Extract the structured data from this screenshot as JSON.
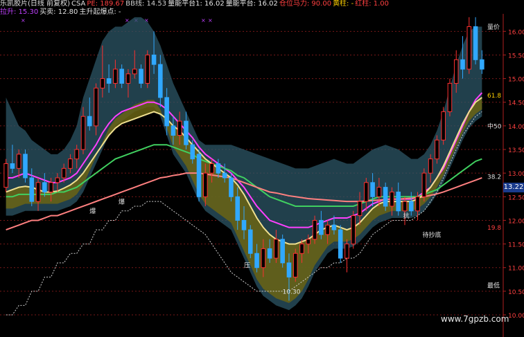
{
  "header": {
    "line1": [
      {
        "text": "乐凯胶片(日线 前复权)",
        "color": "#e0e0e0"
      },
      {
        "text": "CSA",
        "color": "#e0e0e0"
      },
      {
        "text": "PE: 189.67",
        "color": "#ff4040"
      },
      {
        "text": "BB线: 14.53",
        "color": "#d0d0d0"
      },
      {
        "text": "量能平台1: 16.02",
        "color": "#e8e8e8"
      },
      {
        "text": "量能平台: 16.02",
        "color": "#e8e8e8"
      },
      {
        "text": "仓位马力: 90.00",
        "color": "#ff4040"
      },
      {
        "text": "黄柱: -",
        "color": "#ffd000"
      },
      {
        "text": "红柱: 1.00",
        "color": "#ff4040"
      }
    ],
    "line2": [
      {
        "text": "拉升: 15.30",
        "color": "#c040ff"
      },
      {
        "text": "买卖: 12.80",
        "color": "#e0e0e0"
      },
      {
        "text": "主升起爆点: -",
        "color": "#e0e0e0"
      }
    ]
  },
  "watermark": "www.7gpzb.com",
  "current_price": "13.22",
  "chart_data": {
    "type": "candlestick",
    "ylim": [
      10.0,
      16.4
    ],
    "y_ticks": [
      "16.00",
      "15.50",
      "15.00",
      "14.50",
      "14.00",
      "13.50",
      "13.00",
      "12.50",
      "12.00",
      "11.50",
      "11.00",
      "10.50",
      "10.00"
    ],
    "annotations": [
      {
        "label": "量价",
        "x": 111,
        "y": 16.05,
        "color": "#e0e0e0"
      },
      {
        "label": "61.8",
        "x": 109,
        "y": 14.6,
        "color": "#ffd000"
      },
      {
        "label": "中50",
        "x": 109,
        "y": 13.95,
        "color": "#e0e0e0"
      },
      {
        "label": "38.2",
        "x": 109,
        "y": 12.88,
        "color": "#e0e0e0"
      },
      {
        "label": "19.8",
        "x": 109,
        "y": 11.8,
        "color": "#ff4040"
      },
      {
        "label": "最低",
        "x": 109,
        "y": 10.58,
        "color": "#e0e0e0"
      },
      {
        "label": "10.30",
        "x": 58,
        "y": 10.45,
        "color": "#e0e0e0"
      },
      {
        "label": "压",
        "x": 50,
        "y": 11.0,
        "color": "#e0e0e0"
      },
      {
        "label": "抗",
        "x": 83,
        "y": 12.05,
        "color": "#e0e0e0"
      },
      {
        "label": "待抄底",
        "x": 87,
        "y": 11.65,
        "color": "#e0e0e0"
      },
      {
        "label": "爆",
        "x": 18,
        "y": 12.15,
        "color": "#e0e0e0"
      },
      {
        "label": "爆",
        "x": 24,
        "y": 12.35,
        "color": "#e0e0e0"
      }
    ],
    "candles": [
      [
        12.7,
        13.3,
        12.6,
        13.2
      ],
      [
        13.2,
        13.6,
        13.0,
        13.1
      ],
      [
        13.1,
        13.5,
        12.9,
        13.4
      ],
      [
        13.4,
        13.5,
        12.8,
        12.9
      ],
      [
        12.9,
        13.1,
        12.3,
        12.4
      ],
      [
        12.4,
        12.9,
        12.2,
        12.8
      ],
      [
        12.8,
        13.0,
        12.5,
        12.6
      ],
      [
        12.6,
        12.9,
        12.4,
        12.8
      ],
      [
        12.8,
        13.0,
        12.6,
        12.9
      ],
      [
        12.9,
        13.2,
        12.8,
        13.1
      ],
      [
        13.1,
        13.4,
        13.0,
        13.3
      ],
      [
        13.3,
        13.6,
        13.1,
        13.5
      ],
      [
        13.5,
        14.4,
        13.4,
        14.2
      ],
      [
        14.2,
        14.6,
        13.9,
        14.0
      ],
      [
        14.0,
        14.9,
        13.8,
        14.8
      ],
      [
        14.8,
        15.7,
        14.6,
        15.0
      ],
      [
        15.0,
        15.3,
        14.7,
        14.9
      ],
      [
        14.9,
        15.4,
        14.8,
        15.2
      ],
      [
        15.2,
        15.3,
        14.8,
        14.9
      ],
      [
        14.9,
        15.2,
        14.6,
        15.1
      ],
      [
        15.1,
        15.6,
        15.0,
        15.2
      ],
      [
        15.2,
        15.3,
        14.8,
        14.9
      ],
      [
        14.9,
        15.6,
        14.8,
        15.5
      ],
      [
        15.5,
        16.0,
        15.1,
        15.3
      ],
      [
        15.3,
        15.5,
        14.4,
        14.6
      ],
      [
        14.6,
        14.8,
        13.8,
        14.0
      ],
      [
        14.0,
        14.2,
        13.6,
        13.8
      ],
      [
        13.8,
        14.3,
        13.6,
        14.1
      ],
      [
        14.1,
        14.3,
        13.5,
        13.6
      ],
      [
        13.6,
        13.7,
        13.2,
        13.3
      ],
      [
        13.4,
        13.5,
        12.4,
        12.5
      ],
      [
        12.5,
        13.2,
        12.3,
        13.0
      ],
      [
        13.0,
        13.3,
        12.8,
        13.2
      ],
      [
        13.2,
        13.3,
        12.9,
        13.0
      ],
      [
        13.0,
        13.2,
        12.8,
        12.9
      ],
      [
        12.9,
        13.0,
        12.4,
        12.5
      ],
      [
        12.5,
        12.7,
        11.8,
        12.0
      ],
      [
        12.0,
        12.3,
        11.6,
        11.8
      ],
      [
        11.8,
        11.9,
        11.2,
        11.3
      ],
      [
        11.3,
        11.5,
        10.9,
        11.0
      ],
      [
        11.0,
        11.6,
        10.8,
        11.4
      ],
      [
        11.4,
        11.6,
        11.1,
        11.2
      ],
      [
        11.2,
        11.8,
        11.1,
        11.6
      ],
      [
        11.6,
        11.7,
        11.0,
        11.1
      ],
      [
        11.1,
        11.3,
        10.3,
        10.8
      ],
      [
        10.8,
        11.4,
        10.7,
        11.3
      ],
      [
        11.3,
        11.6,
        11.1,
        11.5
      ],
      [
        11.5,
        11.7,
        11.3,
        11.6
      ],
      [
        11.6,
        12.1,
        11.5,
        12.0
      ],
      [
        12.0,
        12.2,
        11.6,
        11.7
      ],
      [
        11.7,
        12.0,
        11.5,
        11.9
      ],
      [
        11.9,
        12.1,
        11.7,
        11.8
      ],
      [
        11.8,
        11.9,
        11.1,
        11.2
      ],
      [
        11.2,
        11.6,
        10.9,
        11.5
      ],
      [
        11.5,
        12.2,
        11.4,
        12.1
      ],
      [
        12.1,
        12.6,
        11.9,
        12.4
      ],
      [
        12.4,
        12.9,
        12.2,
        12.8
      ],
      [
        12.8,
        13.0,
        12.3,
        12.5
      ],
      [
        12.5,
        12.9,
        12.3,
        12.7
      ],
      [
        12.7,
        12.8,
        12.2,
        12.3
      ],
      [
        12.3,
        12.7,
        12.1,
        12.6
      ],
      [
        12.6,
        12.8,
        12.1,
        12.2
      ],
      [
        12.2,
        12.5,
        11.9,
        12.4
      ],
      [
        12.4,
        12.6,
        12.1,
        12.2
      ],
      [
        12.2,
        12.6,
        12.0,
        12.5
      ],
      [
        12.5,
        13.1,
        12.4,
        13.0
      ],
      [
        13.0,
        13.4,
        12.8,
        13.3
      ],
      [
        13.3,
        13.8,
        13.2,
        13.7
      ],
      [
        13.7,
        14.4,
        13.6,
        14.3
      ],
      [
        14.3,
        15.0,
        14.2,
        14.9
      ],
      [
        14.9,
        15.6,
        14.7,
        15.4
      ],
      [
        15.4,
        15.9,
        15.0,
        15.2
      ],
      [
        15.2,
        16.3,
        15.1,
        16.1
      ],
      [
        16.1,
        16.3,
        15.3,
        15.4
      ],
      [
        15.4,
        15.6,
        15.1,
        15.2
      ]
    ],
    "ma_series": [
      {
        "color": "#ff40ff",
        "values": [
          12.9,
          12.9,
          12.95,
          13.0,
          12.95,
          12.9,
          12.85,
          12.8,
          12.8,
          12.85,
          12.9,
          13.0,
          13.2,
          13.4,
          13.6,
          13.85,
          14.05,
          14.2,
          14.3,
          14.35,
          14.4,
          14.45,
          14.5,
          14.5,
          14.45,
          14.35,
          14.2,
          14.05,
          13.9,
          13.75,
          13.55,
          13.4,
          13.3,
          13.2,
          13.1,
          13.0,
          12.85,
          12.7,
          12.5,
          12.3,
          12.15,
          12.0,
          11.95,
          11.9,
          11.85,
          11.85,
          11.85,
          11.85,
          11.9,
          11.95,
          12.0,
          12.05,
          12.05,
          12.05,
          12.1,
          12.15,
          12.25,
          12.35,
          12.4,
          12.45,
          12.45,
          12.45,
          12.45,
          12.45,
          12.5,
          12.6,
          12.7,
          12.9,
          13.1,
          13.4,
          13.7,
          14.0,
          14.3,
          14.55,
          14.7
        ]
      },
      {
        "color": "#40d060",
        "values": [
          12.5,
          12.5,
          12.55,
          12.55,
          12.55,
          12.55,
          12.55,
          12.55,
          12.6,
          12.6,
          12.65,
          12.7,
          12.8,
          12.9,
          13.0,
          13.1,
          13.2,
          13.3,
          13.35,
          13.4,
          13.45,
          13.5,
          13.55,
          13.6,
          13.6,
          13.6,
          13.55,
          13.5,
          13.45,
          13.4,
          13.3,
          13.25,
          13.2,
          13.15,
          13.1,
          13.05,
          12.95,
          12.9,
          12.8,
          12.7,
          12.6,
          12.5,
          12.45,
          12.4,
          12.35,
          12.3,
          12.3,
          12.3,
          12.3,
          12.3,
          12.3,
          12.3,
          12.3,
          12.3,
          12.3,
          12.35,
          12.4,
          12.45,
          12.5,
          12.5,
          12.5,
          12.5,
          12.5,
          12.5,
          12.5,
          12.55,
          12.6,
          12.65,
          12.75,
          12.85,
          12.95,
          13.05,
          13.15,
          13.25,
          13.3
        ]
      },
      {
        "color": "#ff8080",
        "values": [
          11.8,
          11.85,
          11.9,
          11.95,
          12.0,
          12.0,
          12.05,
          12.1,
          12.1,
          12.15,
          12.2,
          12.25,
          12.3,
          12.35,
          12.4,
          12.45,
          12.5,
          12.55,
          12.6,
          12.65,
          12.7,
          12.75,
          12.8,
          12.85,
          12.9,
          12.92,
          12.95,
          12.97,
          13.0,
          13.0,
          13.0,
          12.98,
          12.96,
          12.94,
          12.92,
          12.9,
          12.85,
          12.8,
          12.75,
          12.7,
          12.65,
          12.6,
          12.58,
          12.55,
          12.52,
          12.5,
          12.48,
          12.46,
          12.45,
          12.44,
          12.43,
          12.42,
          12.41,
          12.4,
          12.4,
          12.4,
          12.41,
          12.42,
          12.43,
          12.44,
          12.45,
          12.45,
          12.46,
          12.47,
          12.48,
          12.5,
          12.53,
          12.56,
          12.6,
          12.65,
          12.7,
          12.75,
          12.8,
          12.85,
          12.9
        ]
      },
      {
        "color": "#f0e090",
        "values": [
          12.6,
          12.65,
          12.7,
          12.72,
          12.7,
          12.65,
          12.6,
          12.6,
          12.62,
          12.68,
          12.75,
          12.85,
          13.0,
          13.2,
          13.4,
          13.6,
          13.8,
          13.95,
          14.05,
          14.1,
          14.15,
          14.2,
          14.25,
          14.3,
          14.25,
          14.15,
          14.0,
          13.9,
          13.75,
          13.6,
          13.45,
          13.3,
          13.2,
          13.1,
          13.0,
          12.9,
          12.75,
          12.55,
          12.3,
          12.05,
          11.85,
          11.7,
          11.6,
          11.55,
          11.5,
          11.5,
          11.55,
          11.6,
          11.7,
          11.8,
          11.85,
          11.9,
          11.85,
          11.8,
          11.85,
          11.95,
          12.1,
          12.25,
          12.35,
          12.4,
          12.4,
          12.4,
          12.4,
          12.4,
          12.45,
          12.55,
          12.7,
          12.9,
          13.15,
          13.45,
          13.75,
          14.05,
          14.3,
          14.5,
          14.6
        ]
      }
    ],
    "band_upper": [
      14.6,
      14.3,
      14.0,
      13.9,
      13.7,
      13.6,
      13.5,
      13.4,
      13.4,
      13.5,
      13.7,
      14.0,
      14.6,
      15.0,
      15.4,
      15.8,
      16.0,
      16.1,
      16.1,
      16.2,
      16.3,
      16.3,
      16.2,
      16.0,
      15.7,
      15.3,
      14.9,
      14.6,
      14.3,
      14.0,
      13.7,
      13.6,
      13.6,
      13.6,
      13.6,
      13.6,
      13.55,
      13.5,
      13.45,
      13.4,
      13.35,
      13.3,
      13.25,
      13.2,
      13.15,
      13.1,
      13.1,
      13.1,
      13.15,
      13.2,
      13.25,
      13.3,
      13.25,
      13.2,
      13.2,
      13.3,
      13.4,
      13.5,
      13.55,
      13.6,
      13.55,
      13.5,
      13.4,
      13.3,
      13.3,
      13.4,
      13.6,
      13.9,
      14.3,
      14.8,
      15.3,
      15.7,
      16.0,
      16.1,
      16.1
    ],
    "band_lower": [
      12.1,
      12.1,
      12.15,
      12.2,
      12.2,
      12.2,
      12.2,
      12.2,
      12.2,
      12.25,
      12.3,
      12.4,
      12.6,
      12.9,
      13.2,
      13.5,
      13.8,
      14.0,
      14.1,
      14.2,
      14.3,
      14.35,
      14.4,
      14.4,
      14.2,
      13.8,
      13.4,
      13.2,
      13.0,
      12.7,
      12.4,
      12.2,
      12.1,
      12.0,
      11.9,
      11.8,
      11.5,
      11.2,
      10.9,
      10.6,
      10.4,
      10.3,
      10.2,
      10.15,
      10.1,
      10.2,
      10.35,
      10.6,
      10.9,
      11.1,
      11.3,
      11.4,
      11.4,
      11.4,
      11.45,
      11.55,
      11.7,
      11.85,
      11.95,
      12.0,
      12.05,
      12.05,
      12.05,
      12.05,
      12.1,
      12.2,
      12.35,
      12.55,
      12.8,
      13.1,
      13.4,
      13.7,
      13.95,
      14.1,
      14.2
    ],
    "support_step": [
      10.0,
      10.0,
      10.2,
      10.2,
      10.5,
      10.5,
      10.8,
      10.8,
      11.1,
      11.1,
      11.3,
      11.3,
      11.5,
      11.5,
      11.8,
      11.8,
      12.0,
      12.0,
      12.2,
      12.2,
      12.3,
      12.3,
      12.4,
      12.4,
      12.4,
      12.3,
      12.2,
      12.1,
      12.0,
      11.9,
      11.8,
      11.7,
      11.5,
      11.3,
      11.1,
      10.9,
      10.8,
      10.7,
      10.6,
      10.5,
      10.5,
      10.5,
      10.5,
      10.5,
      10.5,
      10.6,
      10.7,
      10.8,
      10.9,
      11.0,
      11.0,
      11.1,
      11.1,
      11.2,
      11.2,
      11.3,
      11.5,
      11.7,
      11.8,
      11.9,
      12.0,
      12.0,
      12.0,
      12.0,
      12.1,
      12.2,
      12.4,
      12.6,
      12.9,
      13.2,
      13.5,
      13.8,
      14.0,
      14.2,
      14.3
    ]
  }
}
